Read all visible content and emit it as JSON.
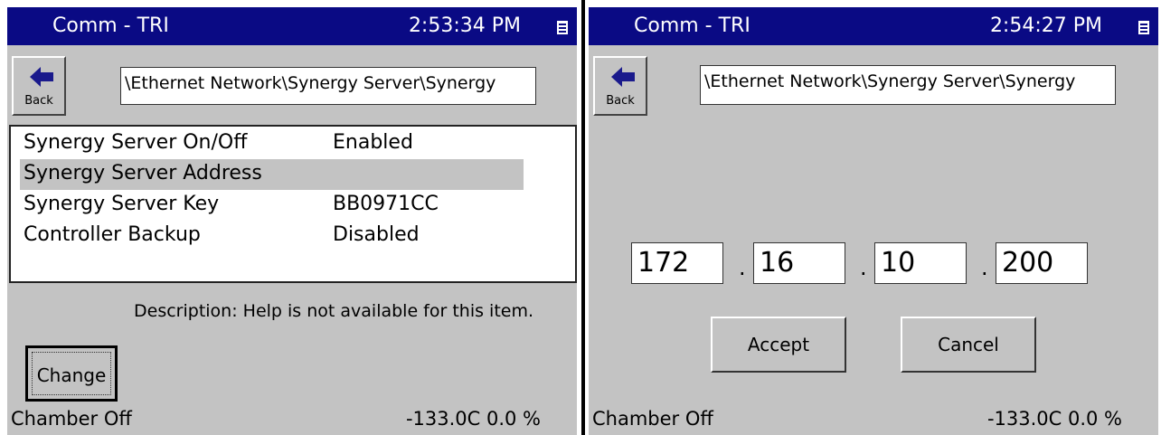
{
  "left": {
    "title": "Comm - TRI",
    "time": "2:53:34 PM",
    "back_label": "Back",
    "path": "\\Ethernet Network\\Synergy Server\\Synergy",
    "items": [
      {
        "label": "Synergy Server On/Off",
        "value": "Enabled"
      },
      {
        "label": "Synergy Server Address",
        "value": ""
      },
      {
        "label": "Synergy Server Key",
        "value": "BB0971CC"
      },
      {
        "label": "Controller Backup",
        "value": "Disabled"
      }
    ],
    "selected_index": 1,
    "description": "Description:  Help is not available for this item.",
    "change_label": "Change",
    "status_left": "Chamber Off",
    "status_right": "-133.0C  0.0 %"
  },
  "right": {
    "title": "Comm - TRI",
    "time": "2:54:27 PM",
    "back_label": "Back",
    "path": "\\Ethernet Network\\Synergy Server\\Synergy",
    "ip": [
      "172",
      "16",
      "10",
      "200"
    ],
    "dot": ".",
    "accept_label": "Accept",
    "cancel_label": "Cancel",
    "status_left": "Chamber Off",
    "status_right": "-133.0C  0.0 %"
  },
  "colors": {
    "titlebar": "#0a0a84",
    "panel_bg": "#c3c3c3",
    "arrow": "#1a1a8c"
  },
  "icons": {
    "back": "left-arrow-icon",
    "keyboard": "keyboard-icon"
  }
}
